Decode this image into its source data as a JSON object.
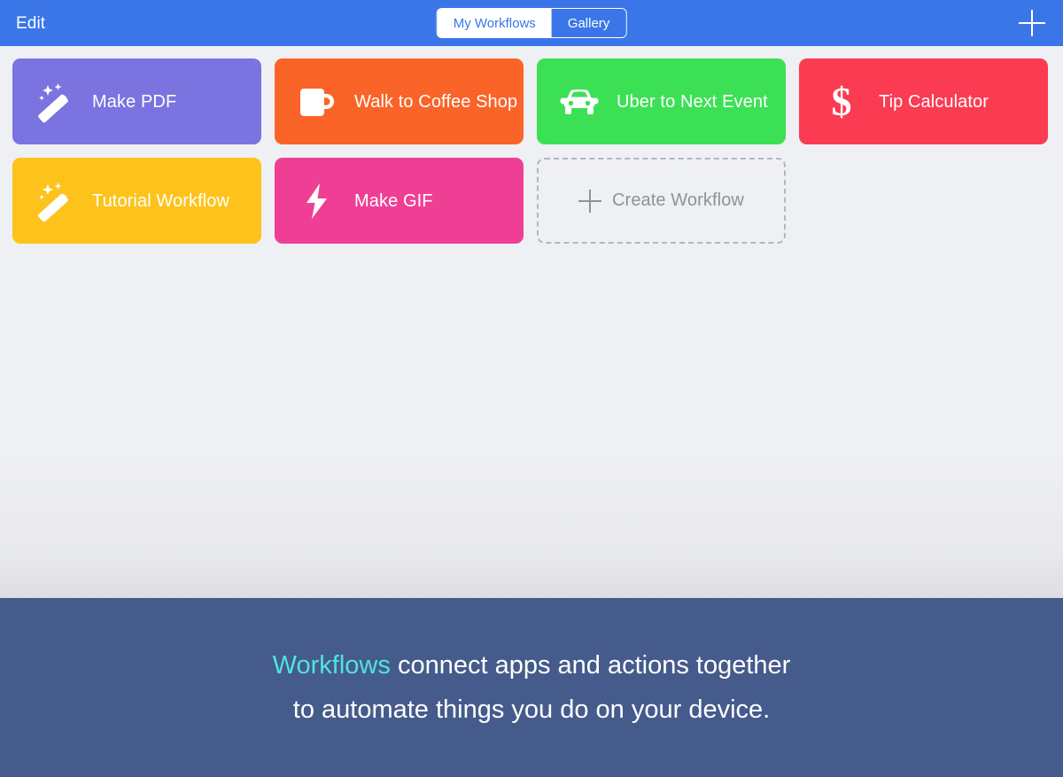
{
  "navbar": {
    "edit_label": "Edit",
    "add_icon": "plus-icon",
    "background_color": "#3a76e8",
    "segments": [
      {
        "label": "My Workflows",
        "selected": true
      },
      {
        "label": "Gallery",
        "selected": false
      }
    ]
  },
  "workflows": [
    {
      "label": "Make PDF",
      "icon": "magic-wand-icon",
      "color": "#7a73e0"
    },
    {
      "label": "Walk to Coffee Shop",
      "icon": "coffee-mug-icon",
      "color": "#fa6428"
    },
    {
      "label": "Uber to Next Event",
      "icon": "car-icon",
      "color": "#3ce055"
    },
    {
      "label": "Tip Calculator",
      "icon": "dollar-sign-icon",
      "color": "#fb3b52"
    },
    {
      "label": "Tutorial Workflow",
      "icon": "magic-wand-icon",
      "color": "#fdc31c"
    },
    {
      "label": "Make GIF",
      "icon": "lightning-bolt-icon",
      "color": "#ef3f94"
    }
  ],
  "create_tile": {
    "label": "Create Workflow",
    "icon": "plus-icon",
    "border_color": "#b3b6bd",
    "text_color": "#8e9299"
  },
  "banner": {
    "background_color": "#455b8c",
    "accent_color": "#4fe3e0",
    "accent_word": "Workflows",
    "line1_rest": " connect apps and actions together",
    "line2": "to automate things you do on your device."
  }
}
